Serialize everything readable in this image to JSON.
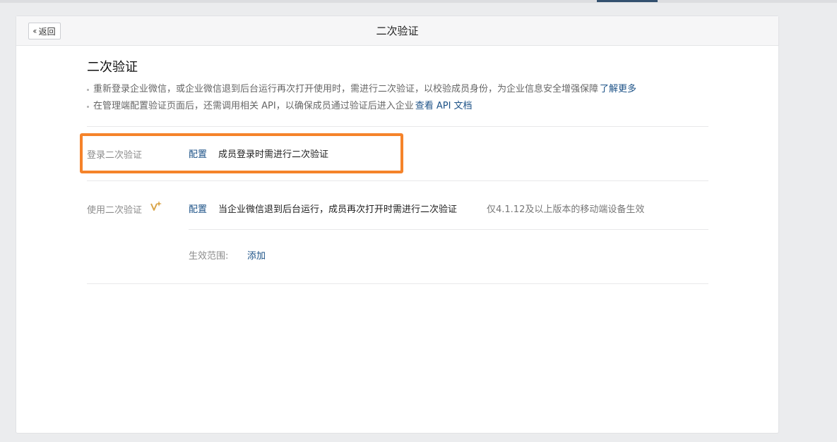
{
  "header": {
    "back_label": "返回",
    "title": "二次验证"
  },
  "intro": {
    "title": "二次验证",
    "notes": [
      {
        "text": "重新登录企业微信，或企业微信退到后台运行再次打开使用时，需进行二次验证，以校验成员身份，为企业信息安全增强保障",
        "link": "了解更多"
      },
      {
        "text": "在管理端配置验证页面后，还需调用相关 API，以确保成员通过验证后进入企业",
        "link": "查看 API 文档"
      }
    ]
  },
  "login_verification": {
    "label": "登录二次验证",
    "config": "配置",
    "description": "成员登录时需进行二次验证"
  },
  "usage_verification": {
    "label": "使用二次验证",
    "config": "配置",
    "description": "当企业微信退到后台运行，成员再次打开时需进行二次验证",
    "version_note": "仅4.1.12及以上版本的移动端设备生效",
    "scope_label": "生效范围:",
    "scope_add": "添加"
  },
  "colors": {
    "accent_link": "#1c5287",
    "highlight": "#f5832a",
    "sparkle": "#d9a54a"
  },
  "icons": [
    "double-chevron-left-icon",
    "sparkle-icon"
  ]
}
